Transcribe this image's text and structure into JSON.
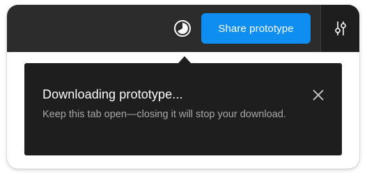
{
  "toolbar": {
    "present_icon": "present-theme-icon",
    "share_label": "Share prototype",
    "settings_icon": "sliders-icon"
  },
  "toast": {
    "title": "Downloading prototype...",
    "message": "Keep this tab open—closing it will stop your download.",
    "close_icon": "close-icon"
  },
  "colors": {
    "toolbar_bg": "#2c2c2c",
    "toast_bg": "#1e1e1e",
    "accent": "#0d8ef0"
  }
}
